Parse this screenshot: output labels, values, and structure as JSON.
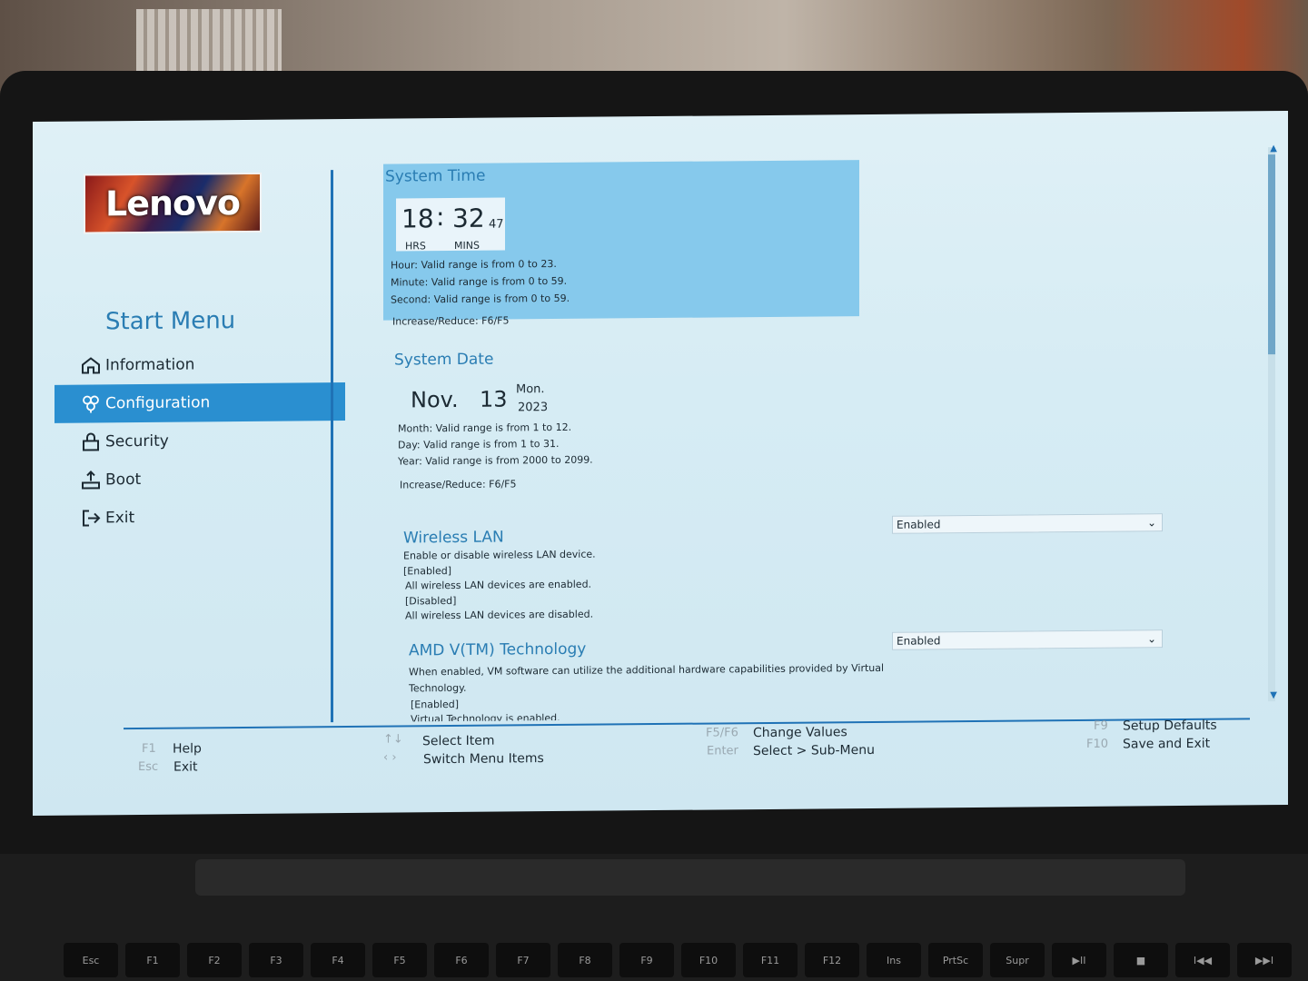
{
  "logo": {
    "text": "Lenovo"
  },
  "sidebar": {
    "title": "Start Menu",
    "items": [
      {
        "label": "Information",
        "icon": "home-icon"
      },
      {
        "label": "Configuration",
        "icon": "configuration-icon",
        "active": true
      },
      {
        "label": "Security",
        "icon": "lock-icon"
      },
      {
        "label": "Boot",
        "icon": "boot-icon"
      },
      {
        "label": "Exit",
        "icon": "exit-icon"
      }
    ]
  },
  "system_time": {
    "title": "System Time",
    "hours": "18",
    "separator": ":",
    "minutes": "32",
    "seconds": "47",
    "hrs_label": "HRS",
    "mins_label": "MINS",
    "hour_range": "Hour: Valid range is from 0 to 23.",
    "minute_range": "Minute: Valid range is from 0 to 59.",
    "second_range": "Second: Valid range is from 0 to 59.",
    "increase_reduce": "Increase/Reduce: F6/F5"
  },
  "system_date": {
    "title": "System Date",
    "month": "Nov.",
    "day": "13",
    "weekday": "Mon.",
    "year": "2023",
    "month_range": "Month: Valid range is from 1 to 12.",
    "day_range": "Day: Valid range is from 1 to 31.",
    "year_range": "Year: Valid range is from 2000 to 2099.",
    "increase_reduce": "Increase/Reduce: F6/F5"
  },
  "wireless_lan": {
    "title": "Wireless LAN",
    "value": "Enabled",
    "desc1": "Enable or disable wireless LAN device.",
    "desc2": "[Enabled]",
    "desc3": "All wireless LAN devices are enabled.",
    "desc4": "[Disabled]",
    "desc5": "All wireless LAN devices are disabled."
  },
  "amd_vt": {
    "title": "AMD V(TM) Technology",
    "value": "Enabled",
    "desc1": "When enabled, VM software can utilize the additional hardware capabilities provided by Virtual",
    "desc2": "Technology.",
    "desc3": "[Enabled]",
    "desc4": "Virtual Technology is enabled."
  },
  "footer": {
    "f1_key": "F1",
    "f1_label": "Help",
    "esc_key": "Esc",
    "esc_label": "Exit",
    "select_label": "Select Item",
    "switch_label": "Switch Menu Items",
    "f5f6_key": "F5/F6",
    "f5f6_label": "Change Values",
    "enter_key": "Enter",
    "enter_label": "Select > Sub-Menu",
    "f9_key": "F9",
    "f9_label": "Setup Defaults",
    "f10_key": "F10",
    "f10_label": "Save and Exit"
  },
  "keyboard": [
    "Esc",
    "F1",
    "F2",
    "F3",
    "F4",
    "F5",
    "F6",
    "F7",
    "F8",
    "F9",
    "F10",
    "F11",
    "F12",
    "Ins",
    "PrtSc",
    "Supr",
    "▶II",
    "■",
    "I◀◀",
    "▶▶I"
  ]
}
